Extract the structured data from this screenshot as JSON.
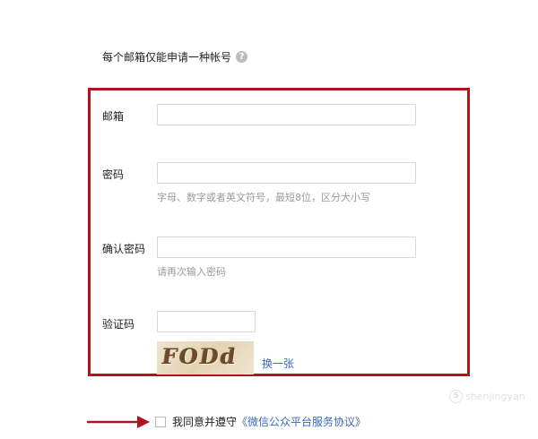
{
  "notice": {
    "text": "每个邮箱仅能申请一种帐号",
    "help_icon": "?"
  },
  "form": {
    "email": {
      "label": "邮箱",
      "value": "",
      "placeholder": ""
    },
    "password": {
      "label": "密码",
      "value": "",
      "placeholder": "",
      "hint": "字母、数字或者英文符号，最短8位，区分大小写"
    },
    "confirm_password": {
      "label": "确认密码",
      "value": "",
      "placeholder": "",
      "hint": "请再次输入密码"
    },
    "captcha": {
      "label": "验证码",
      "value": "",
      "image_text": "FODd",
      "refresh_label": "换一张"
    }
  },
  "agreement": {
    "prefix": "我同意并遵守",
    "link": "《微信公众平台服务协议》",
    "checked": false
  },
  "watermark": {
    "logo": "S",
    "text": "shenjingyan"
  },
  "colors": {
    "highlight_box": "#b0131c",
    "link": "#3a69b7",
    "hint": "#9a9a9a",
    "input_border": "#d9d9d9"
  }
}
